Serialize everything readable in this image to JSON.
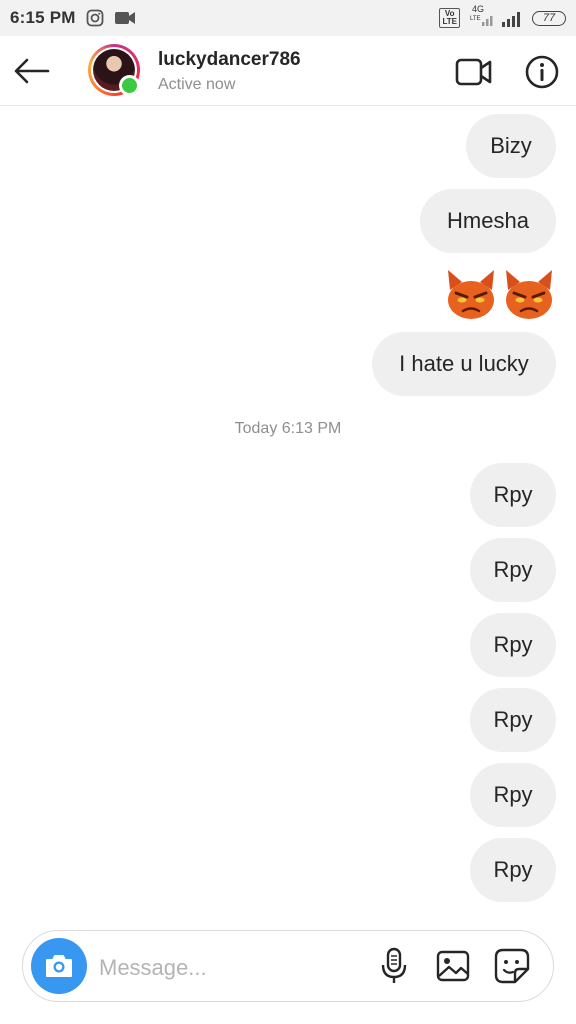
{
  "status_bar": {
    "time": "6:15 PM",
    "network_top": "4G",
    "network_bottom": "LTE",
    "volte_top": "Vo",
    "volte_bottom": "LTE",
    "battery": "77",
    "icons": [
      "instagram-icon",
      "video-camera-icon",
      "volte-icon",
      "signal-icon",
      "battery-icon"
    ]
  },
  "header": {
    "username": "luckydancer786",
    "activity": "Active now",
    "icons": [
      "back-arrow-icon",
      "video-call-icon",
      "info-icon"
    ],
    "online_color": "#3cc941"
  },
  "conversation": {
    "messages_before": [
      {
        "text": "Bizy"
      },
      {
        "text": "Hmesha"
      }
    ],
    "emoji_message": [
      "angry-devil-emoji",
      "angry-devil-emoji"
    ],
    "message_after_emoji": {
      "text": "I hate u lucky"
    },
    "timestamp": "Today 6:13 PM",
    "messages_after": [
      {
        "text": "Rpy"
      },
      {
        "text": "Rpy"
      },
      {
        "text": "Rpy"
      },
      {
        "text": "Rpy"
      },
      {
        "text": "Rpy"
      },
      {
        "text": "Rpy"
      }
    ],
    "bubble_color": "#efefef"
  },
  "composer": {
    "placeholder": "Message...",
    "icons": [
      "camera-icon",
      "microphone-icon",
      "gallery-icon",
      "sticker-icon"
    ],
    "camera_color": "#3897f0"
  }
}
